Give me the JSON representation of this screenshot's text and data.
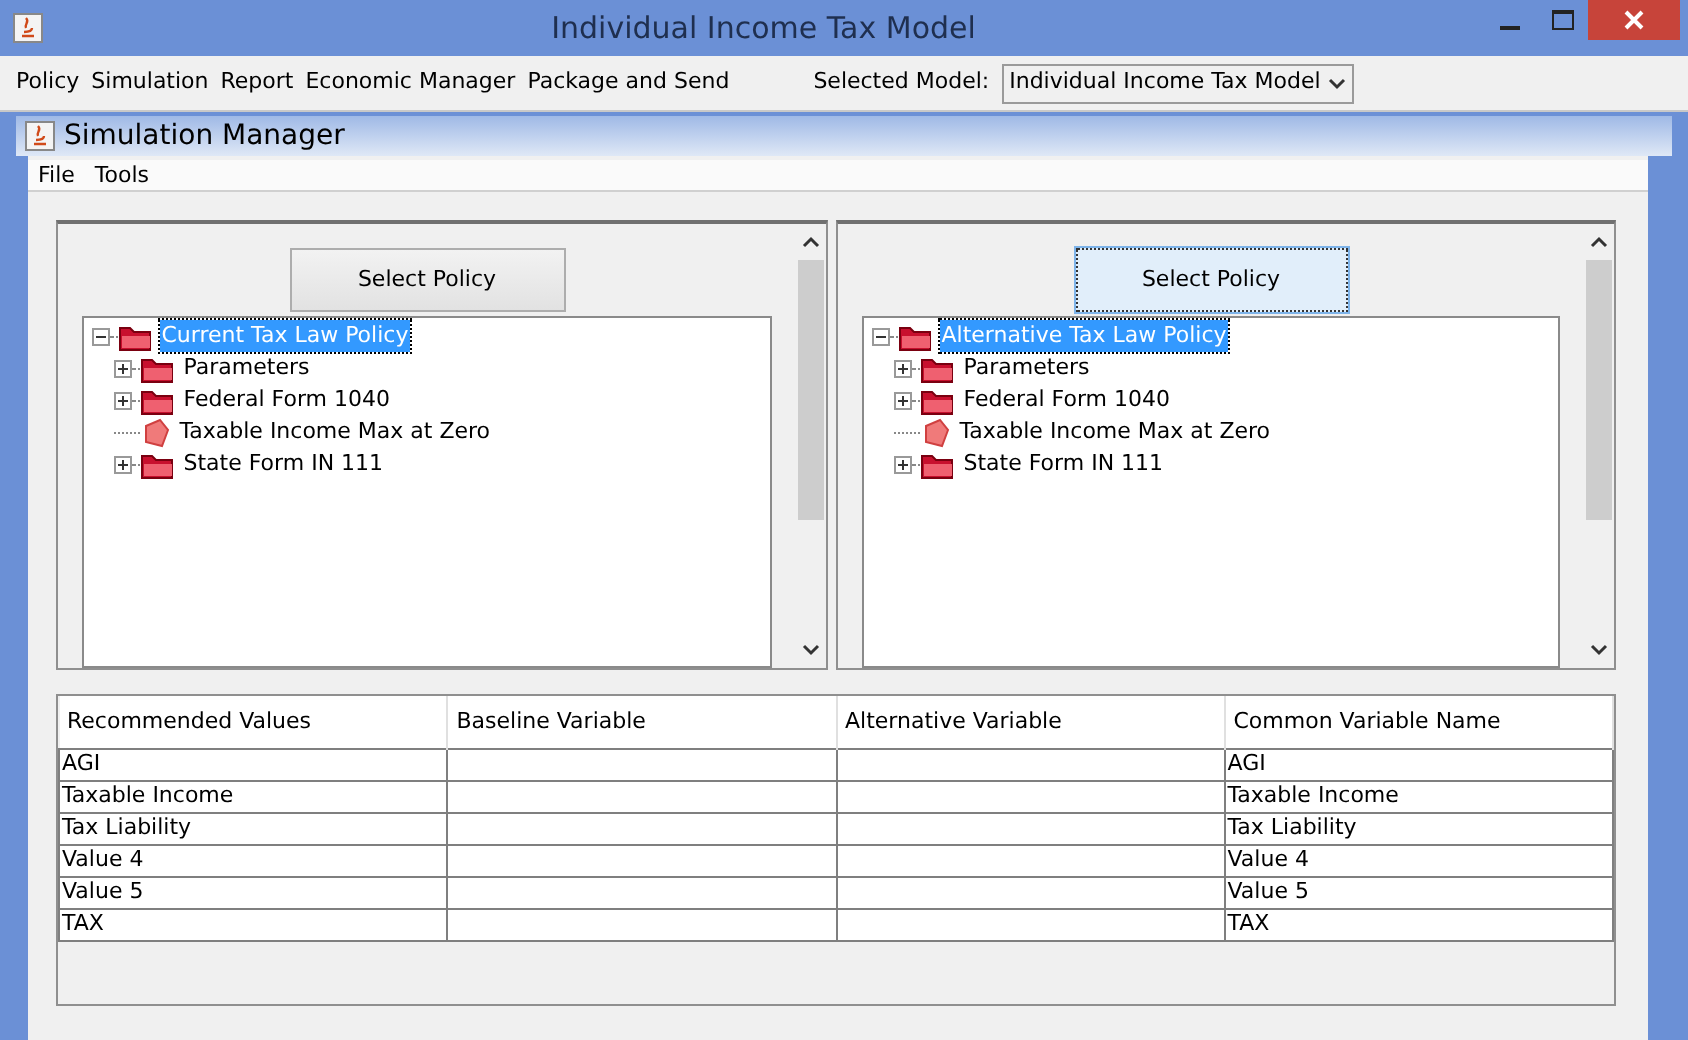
{
  "window": {
    "title": "Individual Income Tax Model"
  },
  "menu_bar": {
    "items": [
      "Policy",
      "Simulation",
      "Report",
      "Economic Manager",
      "Package and Send"
    ],
    "model_label": "Selected Model:",
    "model_value": "Individual Income Tax Model"
  },
  "inner_window": {
    "title": "Simulation Manager",
    "menu": [
      "File",
      "Tools"
    ]
  },
  "panels": [
    {
      "button": {
        "label": "Select Policy",
        "focused": false
      },
      "tree": {
        "label": "Current Tax Law Policy",
        "kind": "folder",
        "expanded": true,
        "selected": true,
        "children": [
          {
            "label": "Parameters",
            "kind": "folder",
            "expanded": false,
            "selected": false
          },
          {
            "label": "Federal Form 1040",
            "kind": "folder",
            "expanded": false,
            "selected": false
          },
          {
            "label": "Taxable Income Max at Zero",
            "kind": "leaf",
            "selected": false
          },
          {
            "label": "State Form IN 111",
            "kind": "folder",
            "expanded": false,
            "selected": false
          }
        ]
      }
    },
    {
      "button": {
        "label": "Select Policy",
        "focused": true
      },
      "tree": {
        "label": "Alternative Tax Law Policy",
        "kind": "folder",
        "expanded": true,
        "selected": true,
        "children": [
          {
            "label": "Parameters",
            "kind": "folder",
            "expanded": false,
            "selected": false
          },
          {
            "label": "Federal Form 1040",
            "kind": "folder",
            "expanded": false,
            "selected": false
          },
          {
            "label": "Taxable Income Max at Zero",
            "kind": "leaf",
            "selected": false
          },
          {
            "label": "State Form IN 111",
            "kind": "folder",
            "expanded": false,
            "selected": false
          }
        ]
      }
    }
  ],
  "table": {
    "columns": [
      "Recommended Values",
      "Baseline Variable",
      "Alternative Variable",
      "Common Variable Name"
    ],
    "rows": [
      [
        "AGI",
        "",
        "",
        "AGI"
      ],
      [
        "Taxable Income",
        "",
        "",
        "Taxable Income"
      ],
      [
        "Tax Liability",
        "",
        "",
        "Tax Liability"
      ],
      [
        "Value 4",
        "",
        "",
        "Value 4"
      ],
      [
        "Value 5",
        "",
        "",
        "Value 5"
      ],
      [
        "TAX",
        "",
        "",
        "TAX"
      ]
    ]
  }
}
